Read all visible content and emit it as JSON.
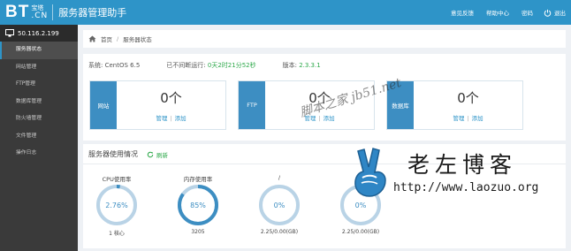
{
  "header": {
    "logo_bt": "BT",
    "logo_top": "宝塔",
    "logo_cn": ".CN",
    "app_title": "服务器管理助手",
    "nav": [
      "意见反馈",
      "帮助中心",
      "密码"
    ],
    "logout": "退出"
  },
  "sidebar": {
    "server_ip": "50.116.2.199",
    "items": [
      {
        "label": "服务器状态",
        "active": true
      },
      {
        "label": "网站管理",
        "active": false
      },
      {
        "label": "FTP管理",
        "active": false
      },
      {
        "label": "数据库管理",
        "active": false
      },
      {
        "label": "防火墙管理",
        "active": false
      },
      {
        "label": "文件管理",
        "active": false
      },
      {
        "label": "操作日志",
        "active": false
      }
    ]
  },
  "breadcrumb": {
    "home": "首页",
    "separator": "/",
    "current": "服务器状态"
  },
  "sysinfo": {
    "system_label": "系统:",
    "system_value": "CentOS 6.5",
    "uptime_label": "已不间断运行:",
    "uptime_value": "0天2时21分52秒",
    "version_label": "版本:",
    "version_value": "2.3.3.1"
  },
  "cards": [
    {
      "tag": "网站",
      "count": "0个",
      "manage": "管理",
      "add": "添加"
    },
    {
      "tag": "FTP",
      "count": "0个",
      "manage": "管理",
      "add": "添加"
    },
    {
      "tag": "数据库",
      "count": "0个",
      "manage": "管理",
      "add": "添加"
    }
  ],
  "usage": {
    "title": "服务器使用情况",
    "refresh": "刷新",
    "gauges": [
      {
        "title": "CPU使用率",
        "value": 2.76,
        "label": "2.76%",
        "sub": "1 核心"
      },
      {
        "title": "内存使用率",
        "value": 85,
        "label": "85%",
        "sub": "3205"
      },
      {
        "title": "/",
        "value": 0,
        "label": "0%",
        "sub": "2.25/0.00(GB)"
      },
      {
        "title": "",
        "value": 0,
        "label": "0%",
        "sub": "2.25/0.00(GB)"
      }
    ]
  },
  "watermark": {
    "diag_text": "脚本之家 jb51.net",
    "brand_cn": "老左博客",
    "brand_url": "http://www.laozuo.org"
  },
  "colors": {
    "header_bg": "#2e94c8",
    "sidebar_bg": "#3a3a3a",
    "card_tag": "#3d8ec2",
    "gauge_track": "#b9d3e6",
    "gauge_fill": "#3d8ec2",
    "green": "#2ea94b"
  },
  "icons": [
    "power-icon",
    "monitor-icon",
    "home-icon",
    "refresh-icon",
    "hand-logo-icon"
  ]
}
